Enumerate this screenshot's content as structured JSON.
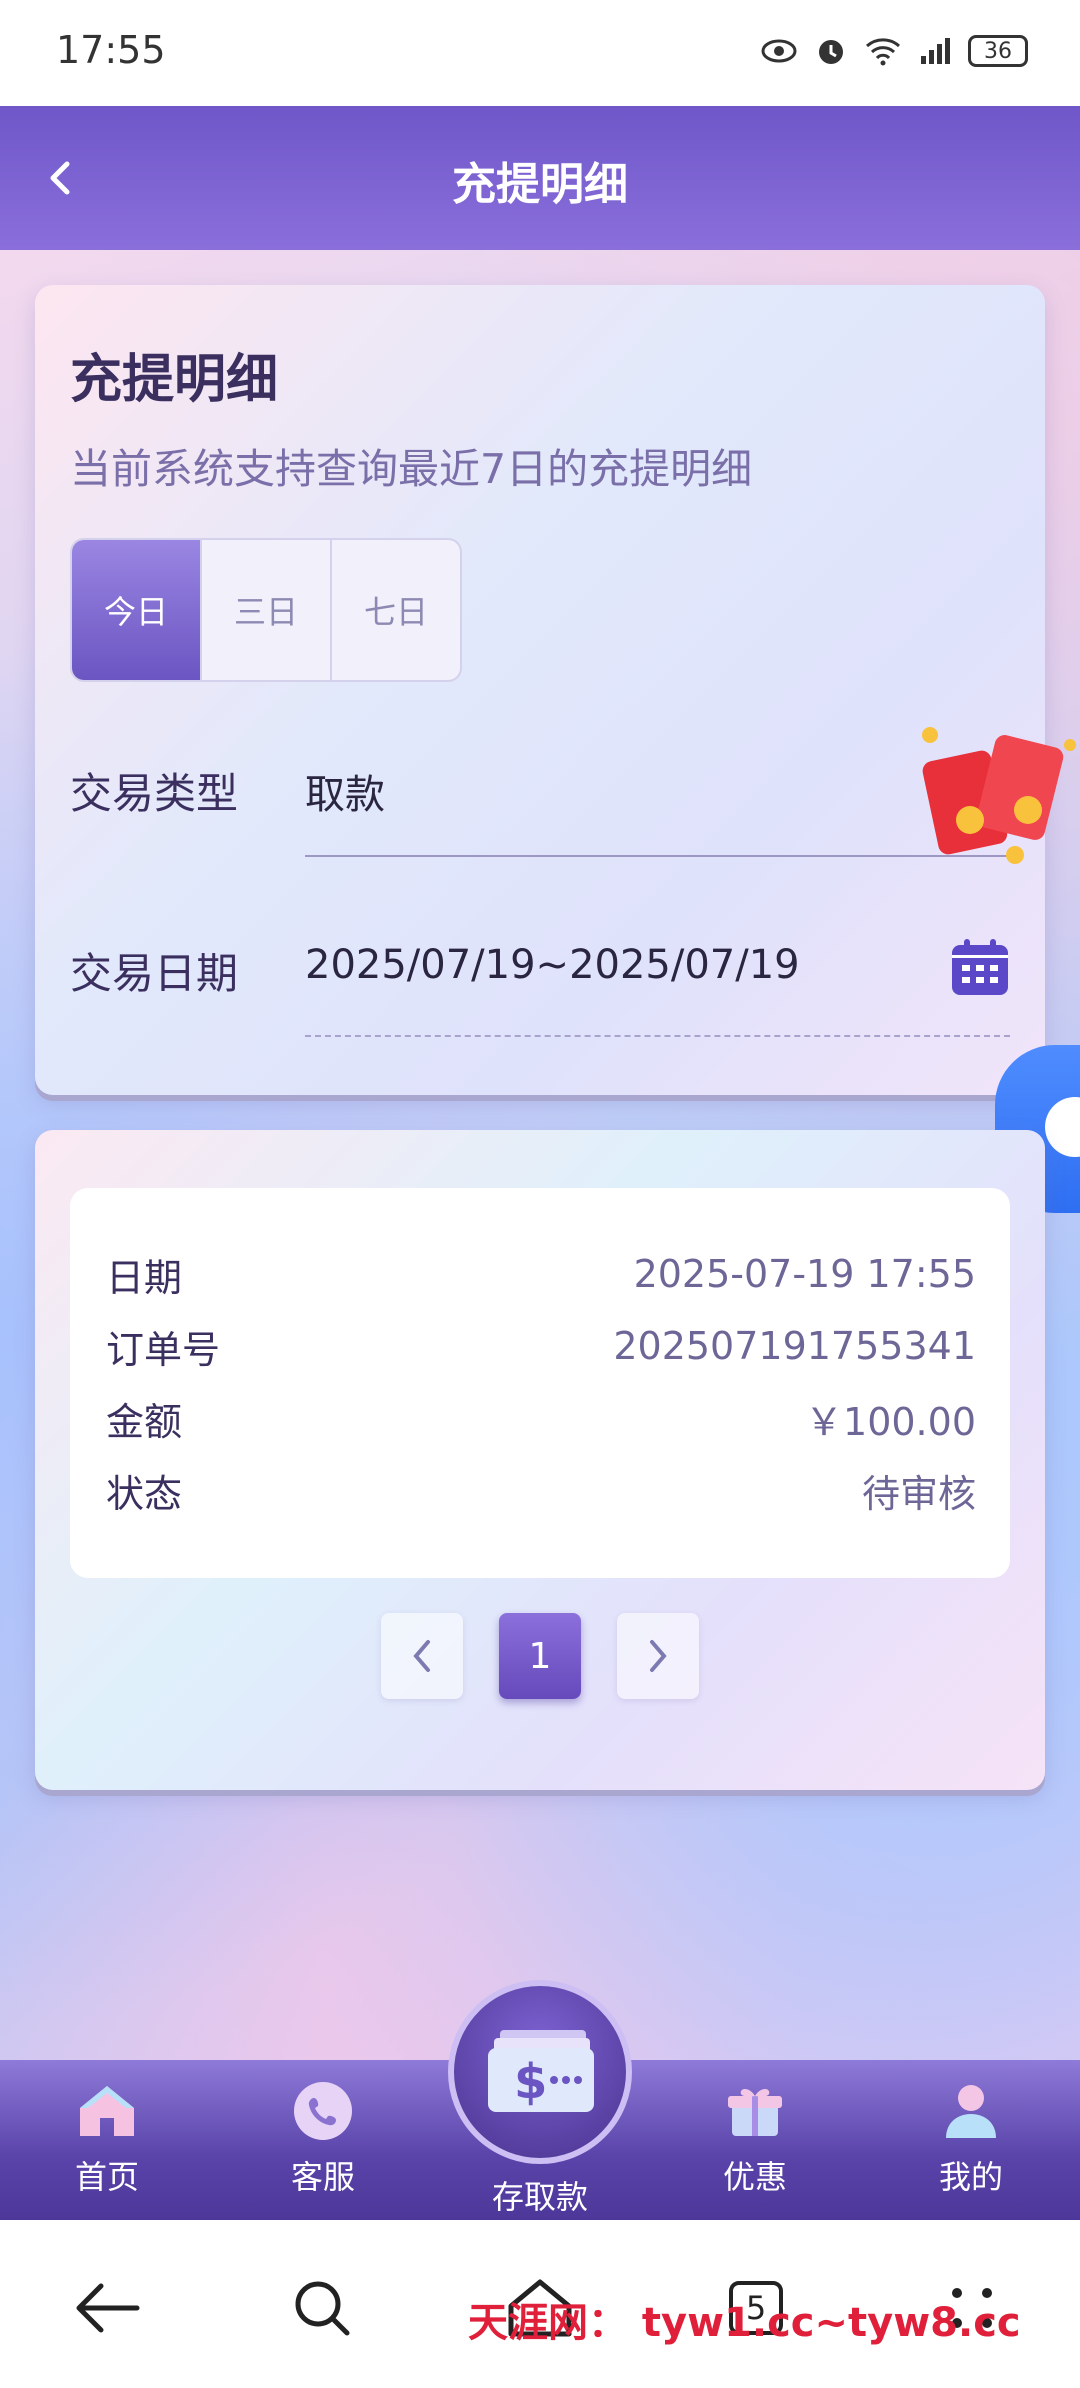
{
  "status_bar": {
    "time": "17:55",
    "battery": "36"
  },
  "header": {
    "title": "充提明细"
  },
  "card": {
    "title": "充提明细",
    "subtitle": "当前系统支持查询最近7日的充提明细",
    "range_tabs": [
      {
        "label": "今日",
        "active": true
      },
      {
        "label": "三日",
        "active": false
      },
      {
        "label": "七日",
        "active": false
      }
    ],
    "type_label": "交易类型",
    "type_value": "取款",
    "date_label": "交易日期",
    "date_value": "2025/07/19~2025/07/19"
  },
  "record": {
    "date_label": "日期",
    "date_value": "2025-07-19 17:55",
    "order_label": "订单号",
    "order_value": "202507191755341",
    "amount_label": "金额",
    "amount_value": "￥100.00",
    "status_label": "状态",
    "status_value": "待审核"
  },
  "pagination": {
    "current_page": "1"
  },
  "bottom_nav": {
    "home": "首页",
    "service": "客服",
    "deposit": "存取款",
    "promo": "优惠",
    "mine": "我的"
  },
  "system_nav": {
    "tabs_count": "5"
  },
  "watermark": "天涯网： tyw1.cc~tyw8.cc",
  "colors": {
    "primary": "#6b55c2",
    "header": "#7b62d2",
    "chat": "#2e6ff2"
  }
}
